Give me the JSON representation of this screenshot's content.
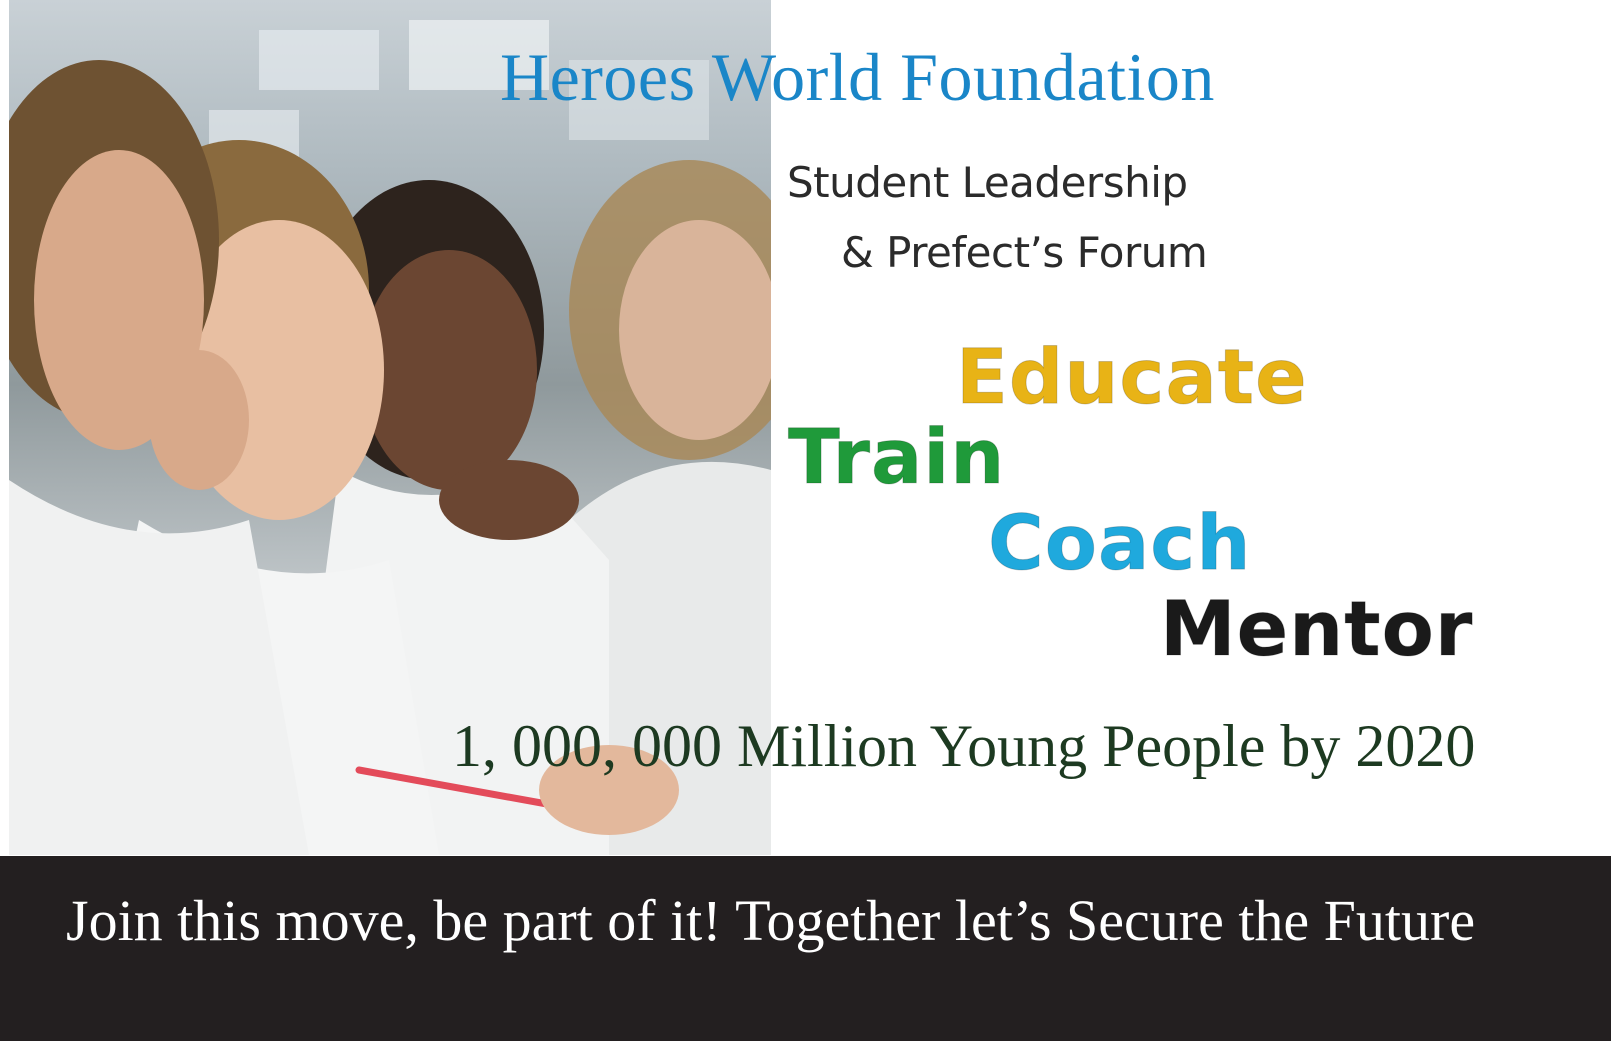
{
  "header": {
    "title": "Heroes World Foundation",
    "subtitle_line1": "Student Leadership",
    "subtitle_line2": "& Prefect’s Forum"
  },
  "pillars": [
    {
      "label": "Educate",
      "color": "#e8b316"
    },
    {
      "label": "Train",
      "color": "#1f9a3a"
    },
    {
      "label": "Coach",
      "color": "#1fa9dd"
    },
    {
      "label": "Mentor",
      "color": "#1a1a1a"
    }
  ],
  "goal": "1, 000, 000 Million Young People by 2020",
  "banner": {
    "text": "Join this move, be part of it! Together let’s Secure the Future"
  },
  "photo": {
    "icon": "students-classroom-photo"
  },
  "colors": {
    "title": "#1a86c8",
    "goal": "#1d3a21",
    "banner_bg": "#231f20",
    "banner_text": "#ffffff"
  }
}
